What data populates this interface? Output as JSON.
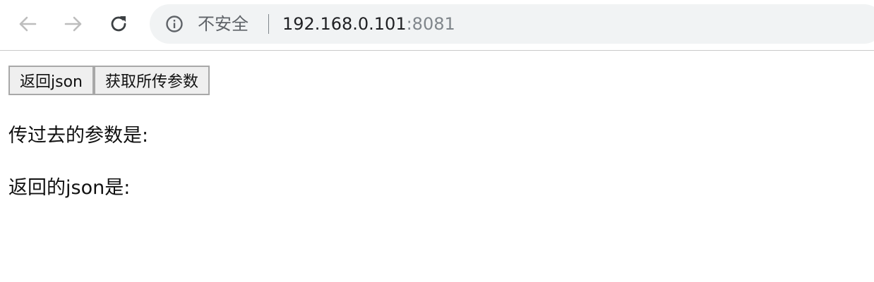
{
  "browser": {
    "security_label": "不安全",
    "url_host": "192.168.0.101",
    "url_port": ":8081"
  },
  "page": {
    "buttons": [
      "返回json",
      "获取所传参数"
    ],
    "params_label": "传过去的参数是:",
    "json_label": "返回的json是:"
  }
}
